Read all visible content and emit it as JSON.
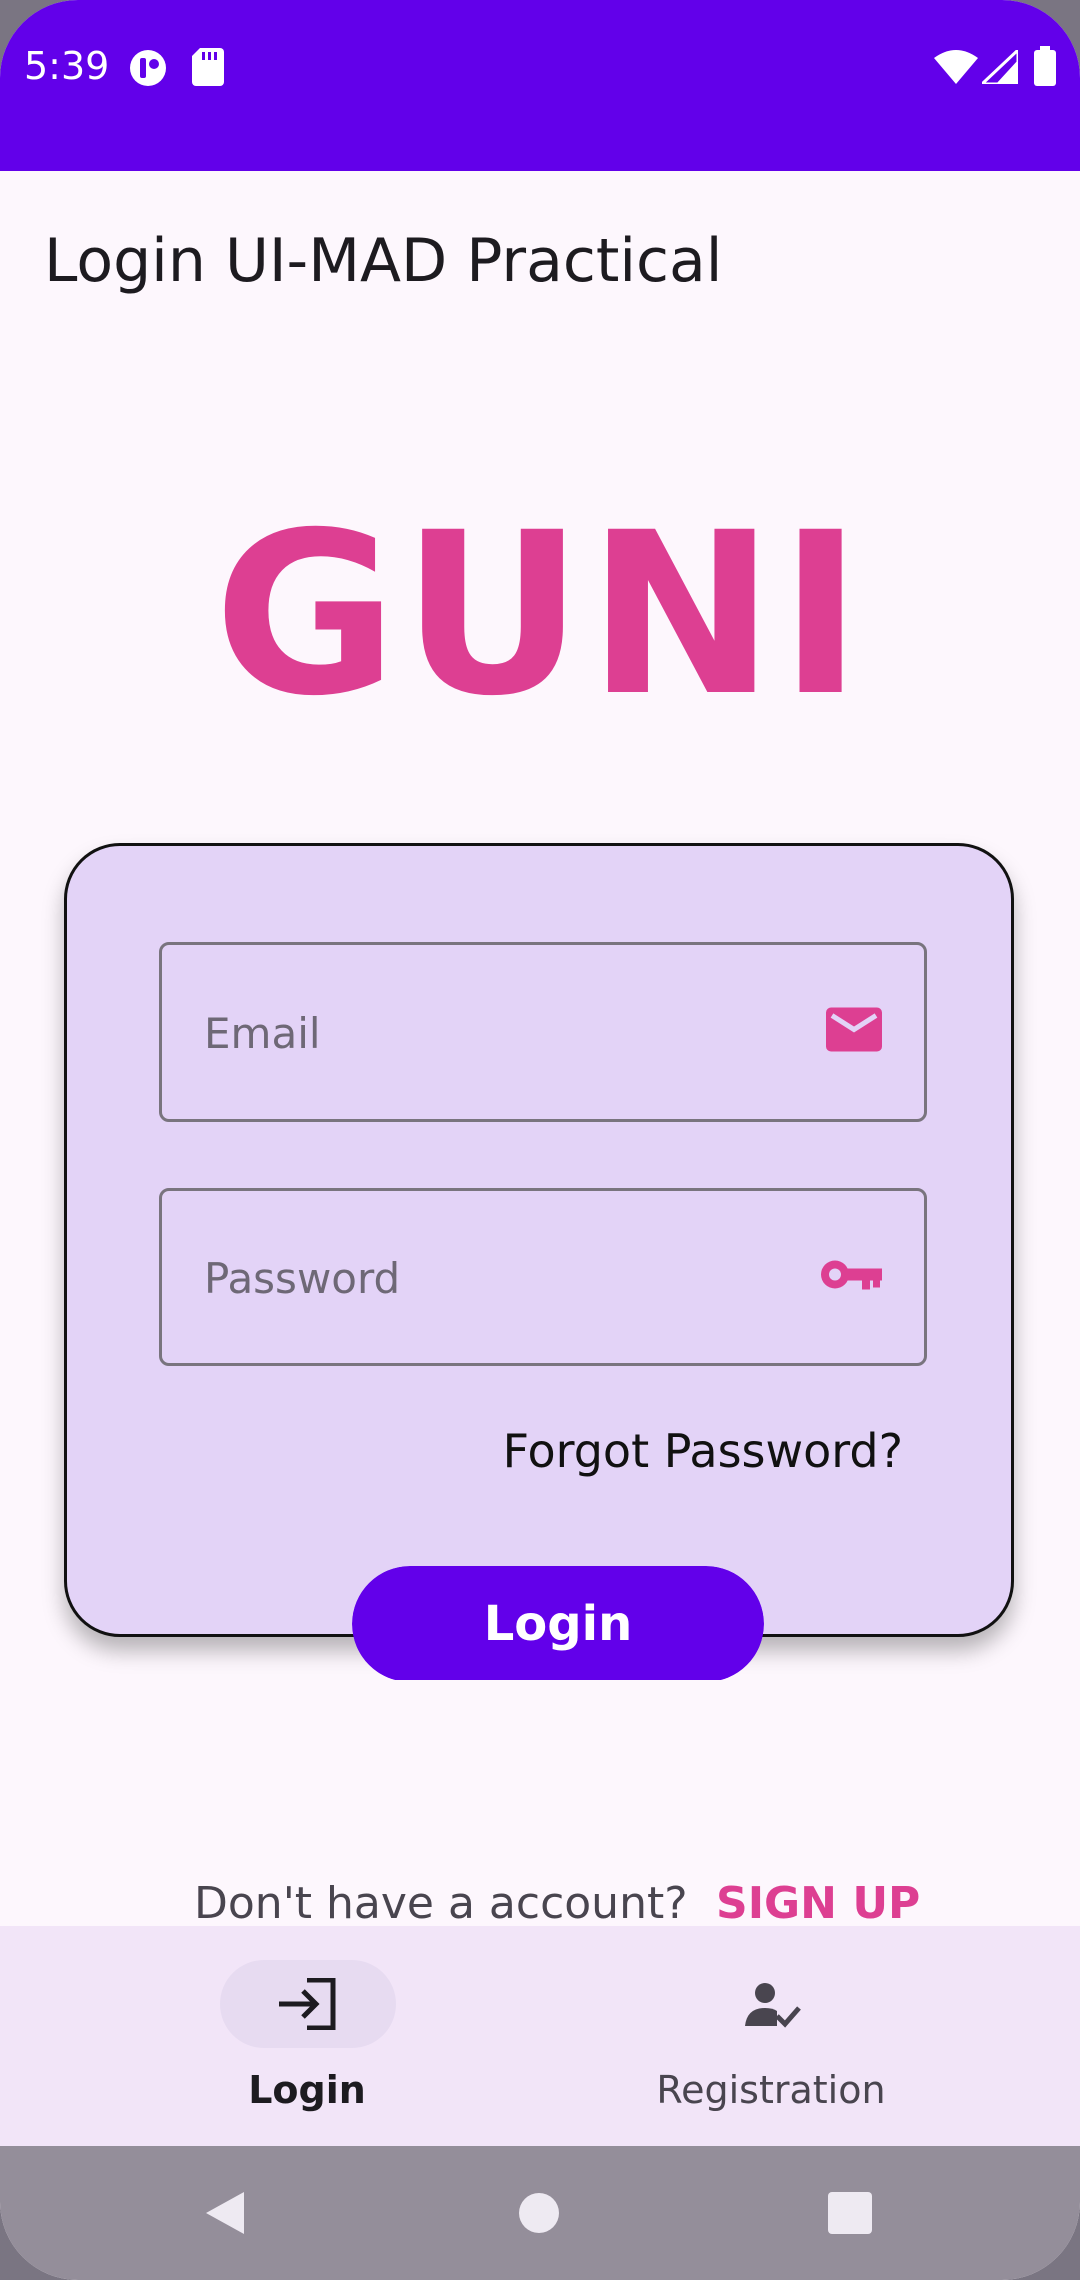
{
  "status_bar": {
    "time": "5:39"
  },
  "app_bar": {
    "title": "Login UI-MAD Practical"
  },
  "logo": {
    "text": "GUNI"
  },
  "form": {
    "email_placeholder": "Email",
    "email_value": "",
    "password_placeholder": "Password",
    "password_value": "",
    "forgot_label": "Forgot Password?",
    "login_label": "Login"
  },
  "signup": {
    "prompt": "Don't have a account?",
    "link_label": "SIGN UP"
  },
  "bottom_nav": {
    "items": [
      {
        "label": "Login",
        "icon": "login-icon",
        "active": true
      },
      {
        "label": "Registration",
        "icon": "person-check-icon",
        "active": false
      }
    ]
  },
  "colors": {
    "primary": "#6200ea",
    "accent": "#dd3f92",
    "card": "#e3d3f7",
    "background": "#fdf7fd"
  }
}
